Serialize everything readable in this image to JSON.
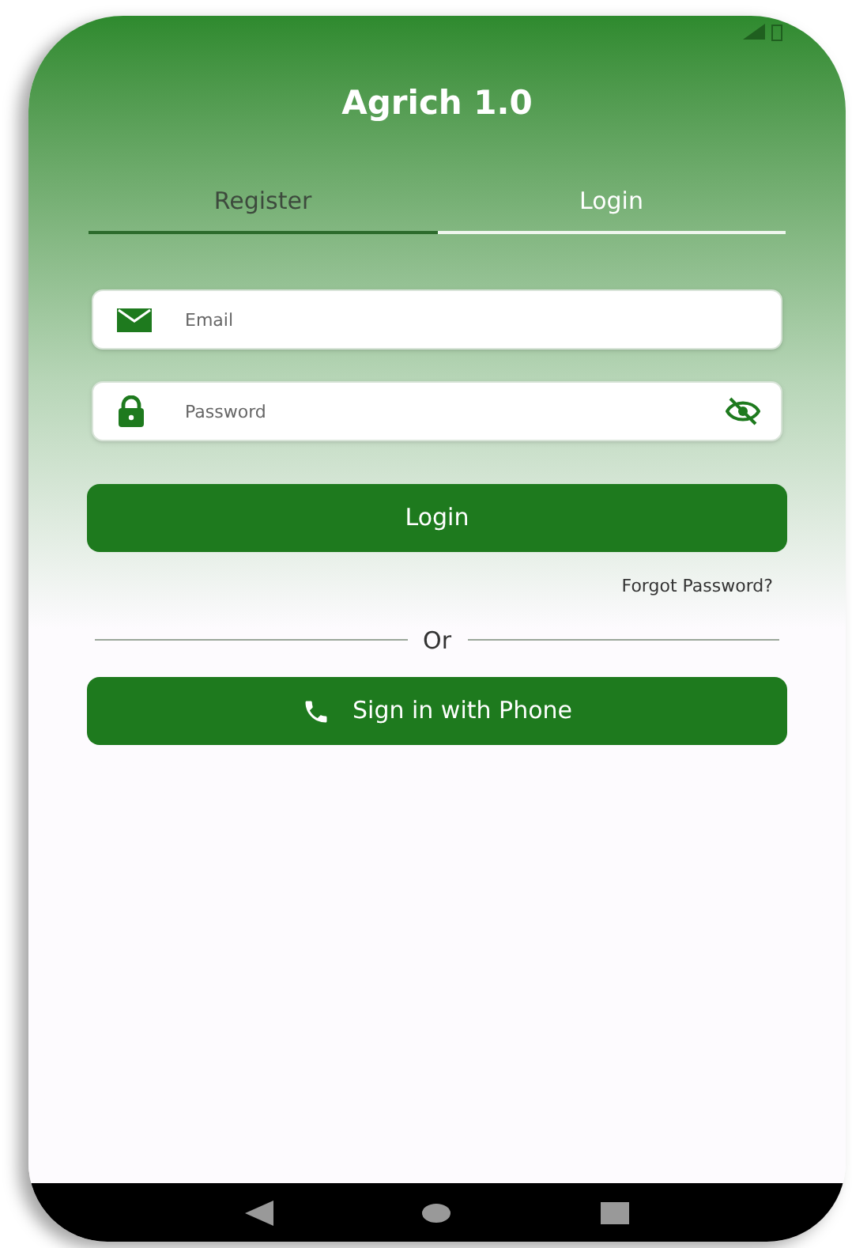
{
  "app": {
    "title": "Agrich 1.0"
  },
  "tabs": [
    {
      "label": "Register",
      "selected": false
    },
    {
      "label": "Login",
      "selected": true
    }
  ],
  "fields": [
    {
      "kind": "email",
      "placeholder": "Email"
    },
    {
      "kind": "password",
      "placeholder": "Password"
    }
  ],
  "login_button": "Login",
  "forgot_link": "Forgot Password?",
  "divider_text": "Or",
  "phone_button": "Sign in with Phone"
}
